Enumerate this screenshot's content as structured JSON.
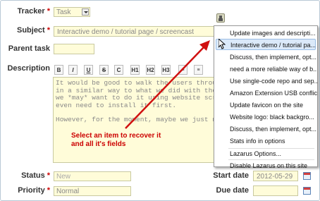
{
  "form": {
    "tracker_label": "Tracker",
    "tracker_value": "Task",
    "subject_label": "Subject",
    "subject_value": "Interactive demo / tutorial page / screencast",
    "parent_task_label": "Parent task",
    "description_label": "Description",
    "status_label": "Status",
    "status_value": "New",
    "priority_label": "Priority",
    "priority_value": "Normal",
    "start_date_label": "Start date",
    "start_date_value": "2012-05-29",
    "due_date_label": "Due date",
    "required_mark": "*"
  },
  "toolbar": {
    "bold": "B",
    "italic": "I",
    "underline": "U",
    "strike": "S",
    "code": "C",
    "h1": "H1",
    "h2": "H2",
    "h3": "H3"
  },
  "editor": {
    "paragraph1_lines": [
      "It would be good to walk the users throu",
      "in a similar way to what we did with the",
      "we *may* want to do it using website scr",
      "even need to install it first."
    ],
    "paragraph2_line": "However, for the moment, maybe we just n"
  },
  "annotation": {
    "line1": "Select an item to recover it",
    "line2": "and all it's fields",
    "color": "#cc0000"
  },
  "menu": {
    "items": [
      "Update images and descripti...",
      "Interactive demo / tutorial pa...",
      "Discuss, then implement, opt...",
      "need a more reliable way of b...",
      "Use single-code repo and sep...",
      "Amazon Extension USB conflict",
      "Update favicon on the site",
      "Website logo: black backgro...",
      "Discuss, then implement, opt...",
      "Stats info in options"
    ],
    "options_label": "Lazarus Options...",
    "disable_label": "Disable Lazarus on this site",
    "highlight_index": 1,
    "highlight_color": "#dbe9f9"
  },
  "colors": {
    "field_bg": "#fffcd9",
    "required": "#cc0000"
  }
}
